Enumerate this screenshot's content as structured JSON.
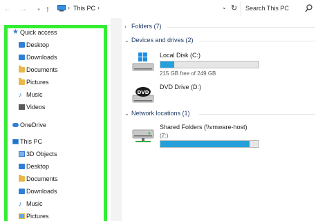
{
  "address_bar": {
    "path": "This PC",
    "search_placeholder": "Search This PC"
  },
  "nav": {
    "quick_access": {
      "label": "Quick access",
      "items": [
        {
          "label": "Desktop",
          "icon": "desktop-folder-icon"
        },
        {
          "label": "Downloads",
          "icon": "downloads-folder-icon"
        },
        {
          "label": "Documents",
          "icon": "documents-folder-icon"
        },
        {
          "label": "Pictures",
          "icon": "pictures-folder-icon"
        },
        {
          "label": "Music",
          "icon": "music-icon"
        },
        {
          "label": "Videos",
          "icon": "videos-icon"
        }
      ]
    },
    "onedrive": {
      "label": "OneDrive"
    },
    "this_pc": {
      "label": "This PC",
      "items": [
        {
          "label": "3D Objects",
          "icon": "3d-objects-icon"
        },
        {
          "label": "Desktop",
          "icon": "desktop-folder-icon"
        },
        {
          "label": "Documents",
          "icon": "documents-folder-icon"
        },
        {
          "label": "Downloads",
          "icon": "downloads-folder-icon"
        },
        {
          "label": "Music",
          "icon": "music-icon"
        },
        {
          "label": "Pictures",
          "icon": "pictures-folder-icon"
        }
      ]
    }
  },
  "content": {
    "folders": {
      "label": "Folders (7)",
      "expanded": false
    },
    "devices": {
      "label": "Devices and drives (2)",
      "drives": [
        {
          "name": "Local Disk (C:)",
          "free_text": "215 GB free of 249 GB",
          "used_fraction": 0.14,
          "icon": "windows-drive-icon"
        },
        {
          "name": "DVD Drive (D:)",
          "icon": "dvd-drive-icon"
        }
      ]
    },
    "network": {
      "label": "Network locations (1)",
      "locations": [
        {
          "name": "Shared Folders (\\\\vmware-host)",
          "sub": "(Z:)",
          "used_fraction": 0.91,
          "icon": "network-drive-icon"
        }
      ]
    }
  },
  "colors": {
    "highlight_box": "#33ee33",
    "bar_fill": "#26a0da",
    "header_text": "#1e3a66"
  }
}
